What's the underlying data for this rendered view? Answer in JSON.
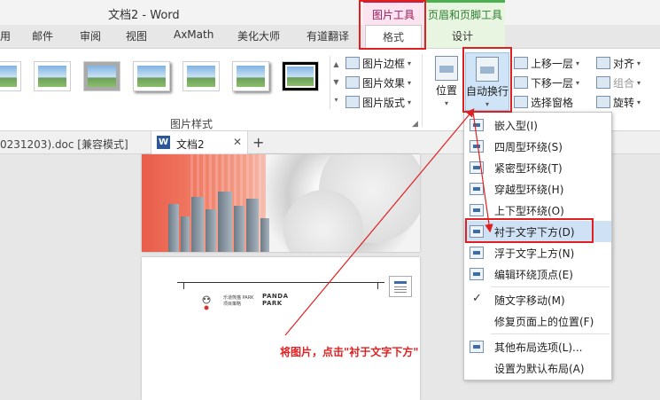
{
  "title_bar": {
    "title": "文档2 - Word"
  },
  "contextual_tabs": {
    "picture_tools": "图片工具",
    "header_footer_tools": "页眉和页脚工具"
  },
  "tabs": [
    {
      "label": "用"
    },
    {
      "label": "邮件"
    },
    {
      "label": "审阅"
    },
    {
      "label": "视图"
    },
    {
      "label": "AxMath"
    },
    {
      "label": "美化大师"
    },
    {
      "label": "有道翻译"
    },
    {
      "label": "格式",
      "active": true
    },
    {
      "label": "设计"
    }
  ],
  "ribbon": {
    "picture_styles": {
      "group_label": "图片样式",
      "border": "图片边框",
      "effects": "图片效果",
      "layout": "图片版式"
    },
    "arrange": {
      "position": "位置",
      "wrap_text": "自动换行",
      "bring_forward": "上移一层",
      "send_backward": "下移一层",
      "selection_pane": "选择窗格",
      "align": "对齐",
      "group": "组合",
      "rotate": "旋转"
    }
  },
  "document_tabs": {
    "previous": "0231203).doc [兼容模式]",
    "current": "文档2",
    "word_glyph": "W",
    "close_glyph": "✕",
    "add_glyph": "+"
  },
  "page_header": {
    "logo_line1": "乐道熊猫 PARK",
    "logo_line2": "项目策略",
    "brand_line1": "PANDA",
    "brand_line2": "PARK"
  },
  "wrap_menu": {
    "items": [
      {
        "label": "嵌入型(I)"
      },
      {
        "label": "四周型环绕(S)"
      },
      {
        "label": "紧密型环绕(T)"
      },
      {
        "label": "穿越型环绕(H)"
      },
      {
        "label": "上下型环绕(O)"
      },
      {
        "label": "衬于文字下方(D)",
        "highlighted": true
      },
      {
        "label": "浮于文字上方(N)"
      },
      {
        "label": "编辑环绕顶点(E)"
      },
      {
        "label": "随文字移动(M)",
        "checked": true
      },
      {
        "label": "修复页面上的位置(F)"
      },
      {
        "label": "其他布局选项(L)..."
      },
      {
        "label": "设置为默认布局(A)"
      }
    ],
    "check_glyph": "✓"
  },
  "annotation": {
    "text": "将图片，点击\"衬于文字下方\""
  },
  "colors": {
    "annotation_red": "#e02020",
    "picture_tools_accent": "#c2185b",
    "header_footer_accent": "#4caf50",
    "menu_highlight": "#cfe2f5"
  }
}
